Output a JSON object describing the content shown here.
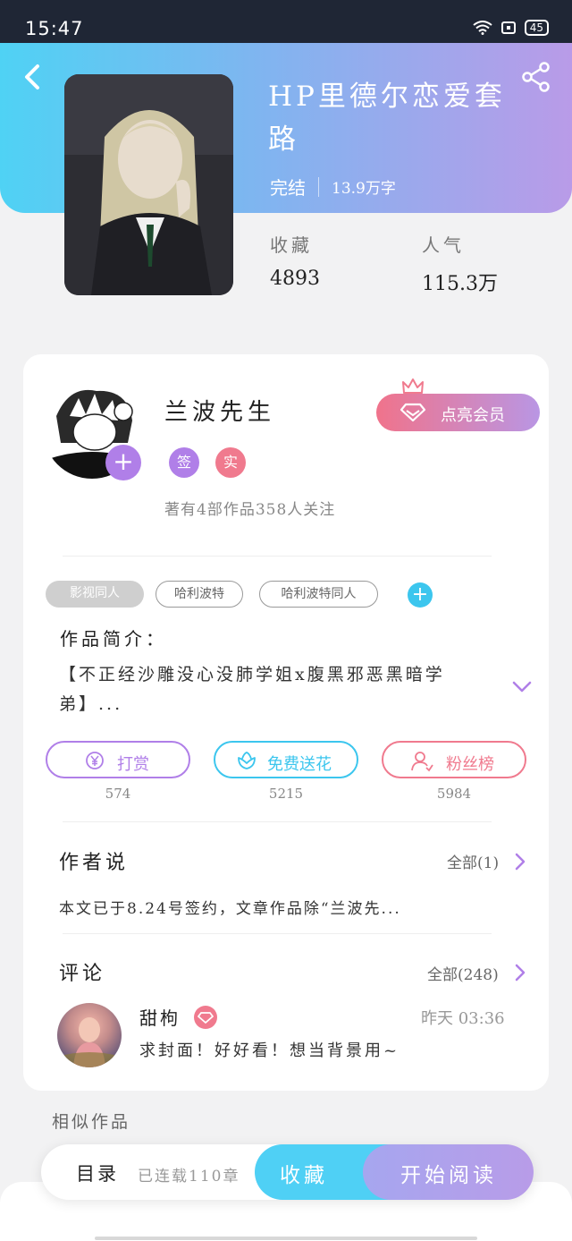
{
  "status_bar": {
    "time": "15:47",
    "battery": "45"
  },
  "book": {
    "title": "HP里德尔恋爱套路",
    "status": "完结",
    "word_count": "13.9万字",
    "stats": [
      {
        "label": "收藏",
        "value": "4893"
      },
      {
        "label": "人气",
        "value": "115.3万"
      }
    ]
  },
  "author": {
    "name": "兰波先生",
    "badges": [
      "签",
      "实"
    ],
    "stats_text": "著有4部作品358人关注",
    "vip_button": "点亮会员"
  },
  "tags": [
    "影视同人",
    "哈利波特",
    "哈利波特同人"
  ],
  "intro": {
    "label": "作品简介：",
    "text": "【不正经沙雕没心没肺学姐x腹黑邪恶黑暗学弟】..."
  },
  "actions": [
    {
      "label": "打赏",
      "count": "574",
      "color": "#b07fe8"
    },
    {
      "label": "免费送花",
      "count": "5215",
      "color": "#3cc6ee"
    },
    {
      "label": "粉丝榜",
      "count": "5984",
      "color": "#f07a8e"
    }
  ],
  "author_say": {
    "title": "作者说",
    "more": "全部(1)",
    "text": "本文已于8.24号签约，文章作品除“兰波先..."
  },
  "comments": {
    "title": "评论",
    "more": "全部(248)",
    "items": [
      {
        "user": "甜枸",
        "time": "昨天 03:36",
        "text": "求封面！好好看！想当背景用~"
      }
    ]
  },
  "similar_title": "相似作品",
  "bottom_bar": {
    "toc_label": "目录",
    "toc_status": "已连载110章",
    "favorite": "收藏",
    "read": "开始阅读"
  },
  "colors": {
    "hero_start": "#4fd2f4",
    "hero_end": "#b99be8",
    "accent_blue": "#3cc6ee",
    "accent_purple": "#b07fe8",
    "accent_pink": "#f07a8e"
  },
  "icons": [
    "back-icon",
    "share-icon",
    "crown-icon",
    "diamond-icon",
    "yuan-coin-icon",
    "flower-icon",
    "fan-user-icon",
    "chevron-down-icon",
    "chevron-right-icon",
    "wifi-icon"
  ]
}
